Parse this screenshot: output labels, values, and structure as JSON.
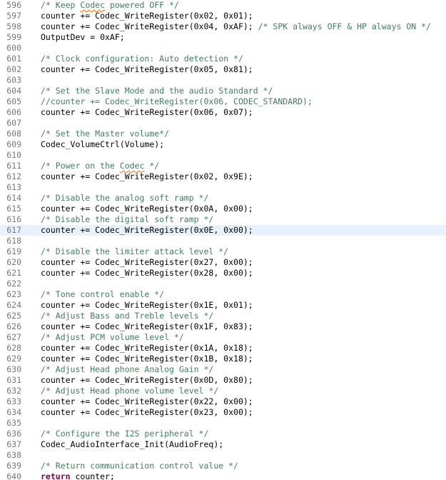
{
  "editor": {
    "current_line": 617,
    "colors": {
      "comment": "#3f7f5f",
      "keyword": "#7f0055",
      "line_number": "#787878",
      "current_line_highlight": "#e8f2fe",
      "spellcheck_squiggle": "#ff6a00"
    },
    "lines": [
      {
        "num": "596",
        "indent": 0,
        "segs": [
          {
            "t": "/* Keep ",
            "k": "cm"
          },
          {
            "t": "Codec",
            "k": "cm sq"
          },
          {
            "t": " powered OFF */",
            "k": "cm"
          }
        ]
      },
      {
        "num": "597",
        "indent": 0,
        "segs": [
          {
            "t": "counter += Codec_WriteRegister(0x02, 0x01);"
          }
        ]
      },
      {
        "num": "598",
        "indent": 0,
        "segs": [
          {
            "t": "counter += Codec_WriteRegister(0x04, 0xAF); "
          },
          {
            "t": "/* SPK always OFF & HP always ON */",
            "k": "cm"
          }
        ]
      },
      {
        "num": "599",
        "indent": 0,
        "segs": [
          {
            "t": "OutputDev = 0xAF;"
          }
        ]
      },
      {
        "num": "600",
        "indent": 0,
        "segs": []
      },
      {
        "num": "601",
        "indent": 0,
        "segs": [
          {
            "t": "/* Clock configuration: Auto detection */",
            "k": "cm"
          }
        ]
      },
      {
        "num": "602",
        "indent": 0,
        "segs": [
          {
            "t": "counter += Codec_WriteRegister(0x05, 0x81);"
          }
        ]
      },
      {
        "num": "603",
        "indent": 0,
        "segs": []
      },
      {
        "num": "604",
        "indent": 0,
        "segs": [
          {
            "t": "/* Set the Slave Mode and the audio Standard */",
            "k": "cm"
          }
        ]
      },
      {
        "num": "605",
        "indent": 0,
        "segs": [
          {
            "t": "//counter += Codec_WriteRegister(0x06, CODEC_STANDARD);",
            "k": "cm"
          }
        ]
      },
      {
        "num": "606",
        "indent": 0,
        "segs": [
          {
            "t": "counter += Codec_WriteRegister(0x06, 0x07);"
          }
        ]
      },
      {
        "num": "607",
        "indent": 0,
        "segs": []
      },
      {
        "num": "608",
        "indent": 0,
        "segs": [
          {
            "t": "/* Set the Master volume*/",
            "k": "cm"
          }
        ]
      },
      {
        "num": "609",
        "indent": 0,
        "segs": [
          {
            "t": "Codec_VolumeCtrl(Volume);"
          }
        ]
      },
      {
        "num": "610",
        "indent": 0,
        "segs": []
      },
      {
        "num": "611",
        "indent": 0,
        "segs": [
          {
            "t": "/* Power on the ",
            "k": "cm"
          },
          {
            "t": "Codec",
            "k": "cm sq"
          },
          {
            "t": " */",
            "k": "cm"
          }
        ]
      },
      {
        "num": "612",
        "indent": 0,
        "segs": [
          {
            "t": "counter += Codec_WriteRegister(0x02, 0x9E);"
          }
        ]
      },
      {
        "num": "613",
        "indent": 0,
        "segs": []
      },
      {
        "num": "614",
        "indent": 0,
        "segs": [
          {
            "t": "/* Disable the analog soft ramp */",
            "k": "cm"
          }
        ]
      },
      {
        "num": "615",
        "indent": 0,
        "segs": [
          {
            "t": "counter += Codec_WriteRegister(0x0A, 0x00);"
          }
        ]
      },
      {
        "num": "616",
        "indent": 0,
        "segs": [
          {
            "t": "/* Disable the digital soft ramp */",
            "k": "cm"
          }
        ]
      },
      {
        "num": "617",
        "indent": 0,
        "segs": [
          {
            "t": "counter += Codec_WriteRegister(0x0E, 0x00);"
          }
        ]
      },
      {
        "num": "618",
        "indent": 0,
        "segs": []
      },
      {
        "num": "619",
        "indent": 0,
        "segs": [
          {
            "t": "/* Disable the limiter attack level */",
            "k": "cm"
          }
        ]
      },
      {
        "num": "620",
        "indent": 0,
        "segs": [
          {
            "t": "counter += Codec_WriteRegister(0x27, 0x00);"
          }
        ]
      },
      {
        "num": "621",
        "indent": 0,
        "segs": [
          {
            "t": "counter += Codec_WriteRegister(0x28, 0x00);"
          }
        ]
      },
      {
        "num": "622",
        "indent": 0,
        "segs": []
      },
      {
        "num": "623",
        "indent": 0,
        "segs": [
          {
            "t": "/* Tone control enable */",
            "k": "cm"
          }
        ]
      },
      {
        "num": "624",
        "indent": 0,
        "segs": [
          {
            "t": "counter += Codec_WriteRegister(0x1E, 0x01);"
          }
        ]
      },
      {
        "num": "625",
        "indent": 0,
        "segs": [
          {
            "t": "/* Adjust Bass and Treble levels */",
            "k": "cm"
          }
        ]
      },
      {
        "num": "626",
        "indent": 0,
        "segs": [
          {
            "t": "counter += Codec_WriteRegister(0x1F, 0x83);"
          }
        ]
      },
      {
        "num": "627",
        "indent": 0,
        "segs": [
          {
            "t": "/* Adjust PCM volume level */",
            "k": "cm"
          }
        ]
      },
      {
        "num": "628",
        "indent": 0,
        "segs": [
          {
            "t": "counter += Codec_WriteRegister(0x1A, 0x18);"
          }
        ]
      },
      {
        "num": "629",
        "indent": 0,
        "segs": [
          {
            "t": "counter += Codec_WriteRegister(0x1B, 0x18);"
          }
        ]
      },
      {
        "num": "630",
        "indent": 0,
        "segs": [
          {
            "t": "/* Adjust Head phone Analog Gain */",
            "k": "cm"
          }
        ]
      },
      {
        "num": "631",
        "indent": 0,
        "segs": [
          {
            "t": "counter += Codec_WriteRegister(0x0D, 0x80);"
          }
        ]
      },
      {
        "num": "632",
        "indent": 0,
        "segs": [
          {
            "t": "/* Adjust Head phone volume level */",
            "k": "cm"
          }
        ]
      },
      {
        "num": "633",
        "indent": 0,
        "segs": [
          {
            "t": "counter += Codec_WriteRegister(0x22, 0x00);"
          }
        ]
      },
      {
        "num": "634",
        "indent": 0,
        "segs": [
          {
            "t": "counter += Codec_WriteRegister(0x23, 0x00);"
          }
        ]
      },
      {
        "num": "635",
        "indent": 0,
        "segs": []
      },
      {
        "num": "636",
        "indent": 0,
        "segs": [
          {
            "t": "/* Configure the I2S peripheral */",
            "k": "cm"
          }
        ]
      },
      {
        "num": "637",
        "indent": 0,
        "segs": [
          {
            "t": "Codec_AudioInterface_Init(AudioFreq);"
          }
        ]
      },
      {
        "num": "638",
        "indent": 0,
        "segs": []
      },
      {
        "num": "639",
        "indent": 0,
        "segs": [
          {
            "t": "/* Return communication control value */",
            "k": "cm"
          }
        ]
      },
      {
        "num": "640",
        "indent": 0,
        "segs": [
          {
            "t": "return",
            "k": "kw"
          },
          {
            "t": " counter;"
          }
        ]
      }
    ]
  }
}
